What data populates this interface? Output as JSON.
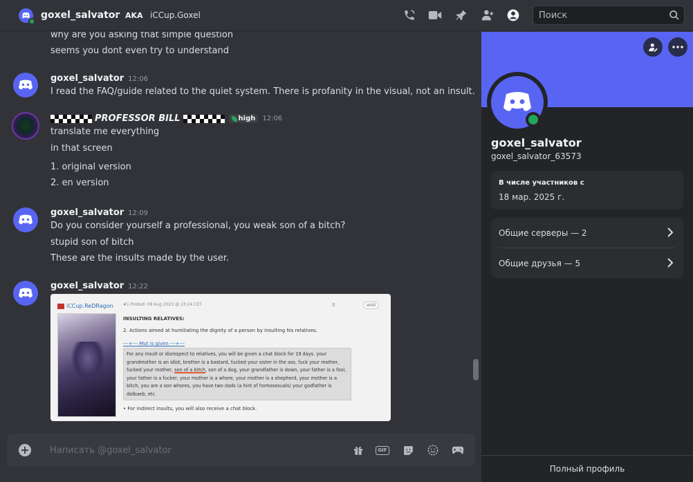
{
  "header": {
    "username": "goxel_salvator",
    "aka_tag": "AKA",
    "aka_value": "iCCup.Goxel",
    "search_placeholder": "Поиск"
  },
  "messages": {
    "m0_line1": "why are you asking that simple question",
    "m0_line2": "seems you dont even try to understand",
    "m1_author": "goxel_salvator",
    "m1_time": "12:06",
    "m1_text": "I read the FAQ/guide related to the quiet system. There is profanity in the visual, not an insult.",
    "m2_author": "PROFESSOR BILL",
    "m2_role": "high",
    "m2_time": "12:06",
    "m2_line1": "translate me everything",
    "m2_line2": "in that screen",
    "m2_line3": "1. original version",
    "m2_line4": "2. en version",
    "m3_author": "goxel_salvator",
    "m3_time": "12:09",
    "m3_line1": "Do you consider yourself a professional, you weak son of a bitch?",
    "m3_line2": "stupid son of bitch",
    "m3_line3": "These are the insults made by the user.",
    "m4_author": "goxel_salvator",
    "m4_time": "12:22"
  },
  "embed": {
    "user": "iCCup.ReDRagon",
    "meta": "#1 Posted: 08 Aug 2023 @ 23:24 CET",
    "votes": "0",
    "reply": "aInti",
    "heading": "INSULTING RELATIVES:",
    "para1": "2. Actions aimed at humiliating the dignity of a person by insulting his relatives.",
    "link": "---+--- Mut is given ---+---",
    "quote_a": "For any insult or disrespect to relatives, you will be given a chat block for 19 days. your grandmother is an idiot, brother is a bastard, fucked your sister in the ass, fuck your mother, fucked your mother, ",
    "quote_ul": "son of a bitch",
    "quote_b": ", son of a dog, your grandfather is down, your father is a fool, your father is a fucker, your mother is a whore, your mother is a shepherd, your mother is a bitch, you are a son whores, you have two dads (a hint of homosexuals) your godfather is dalbaeb, etc.",
    "para2": "• For indirect insults, you will also receive a chat block."
  },
  "composer": {
    "placeholder": "Написать @goxel_salvator"
  },
  "profile": {
    "name": "goxel_salvator",
    "handle": "goxel_salvator_63573",
    "member_label": "В числе участников с",
    "member_since": "18 мар. 2025 г.",
    "mutual_servers": "Общие серверы — 2",
    "mutual_friends": "Общие друзья — 5",
    "full_profile": "Полный профиль"
  },
  "colors": {
    "blurple": "#5865f2",
    "online": "#23a55a",
    "bg": "#323339",
    "panel": "#232428"
  },
  "icons": [
    "phone-icon",
    "video-icon",
    "pin-icon",
    "add-friend-icon",
    "profile-icon",
    "search-icon",
    "plus-icon",
    "gift-icon",
    "gif-icon",
    "sticker-icon",
    "emoji-icon",
    "gamepad-icon",
    "chevron-right-icon",
    "more-icon",
    "user-note-icon"
  ]
}
